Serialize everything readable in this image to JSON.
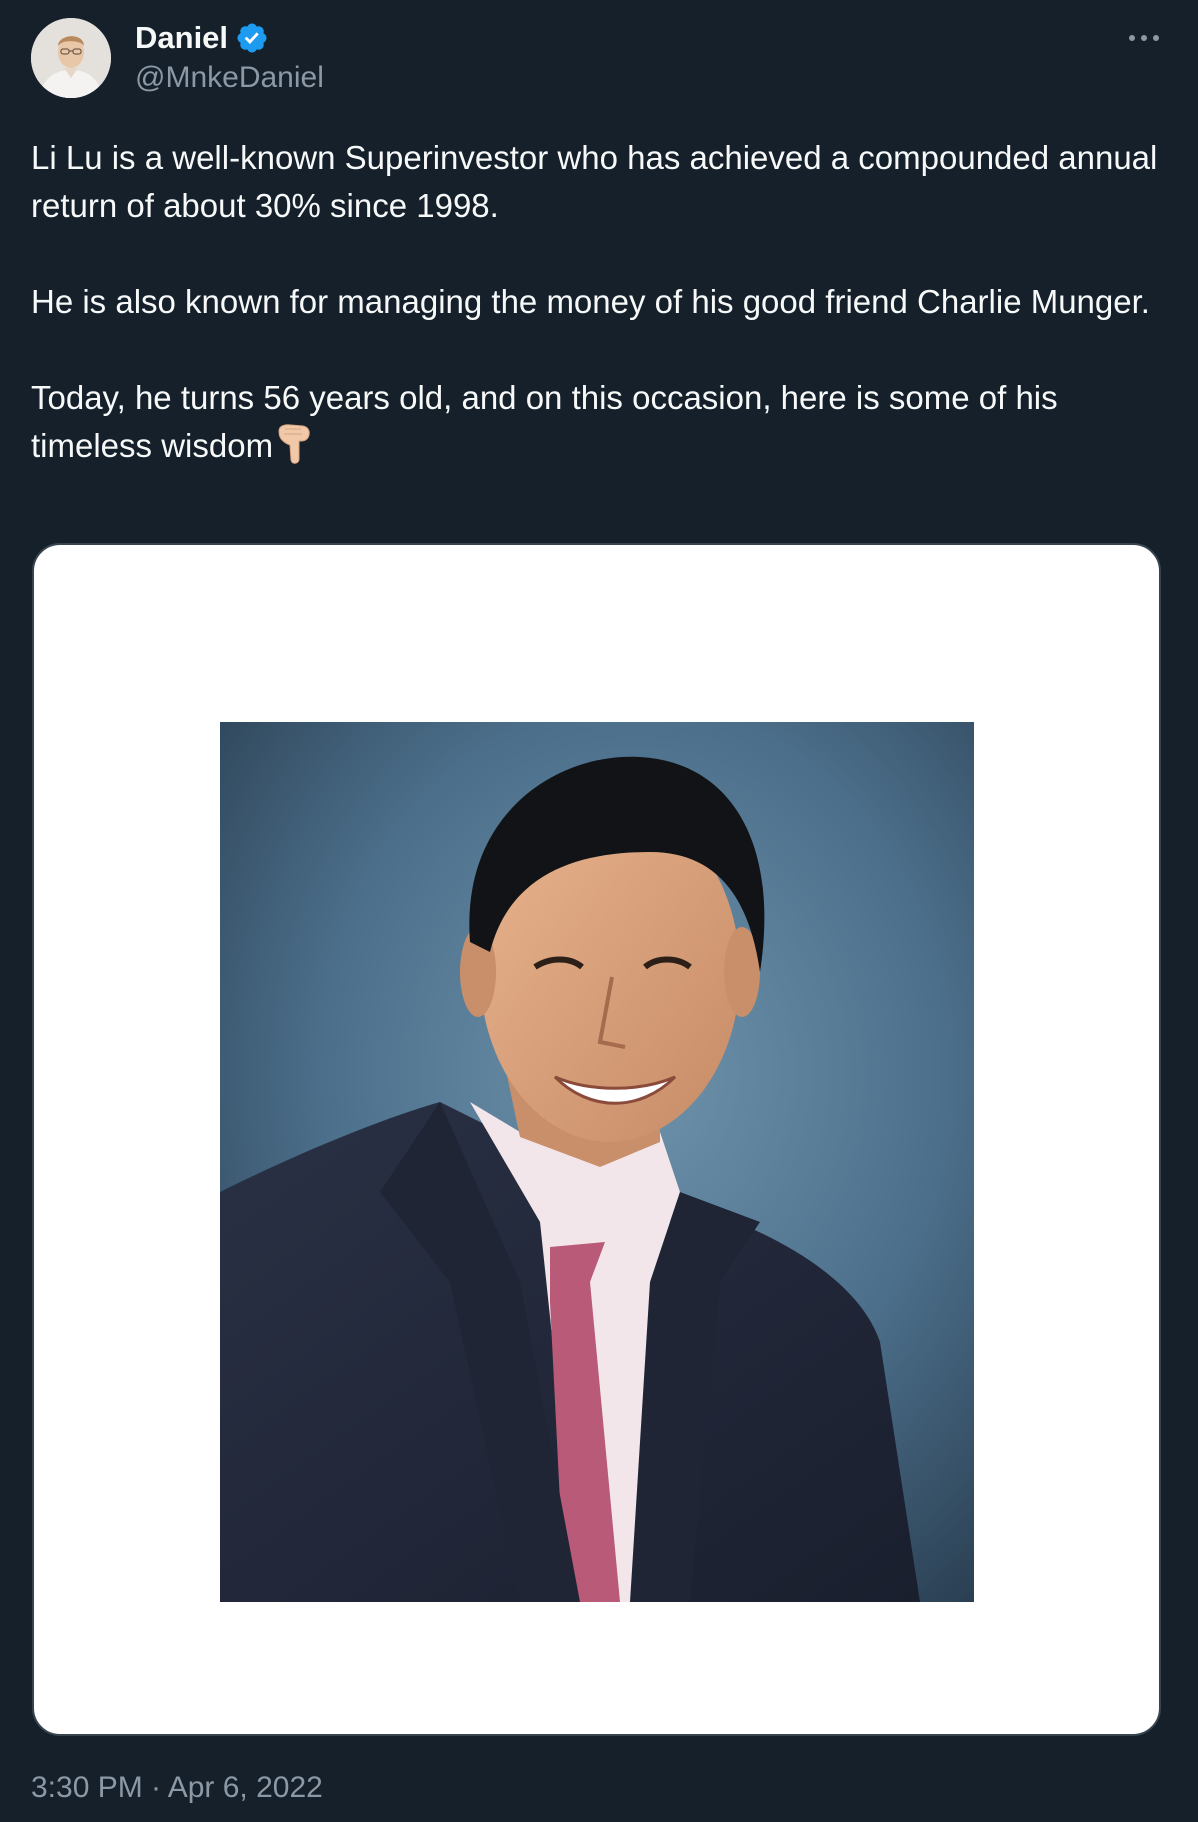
{
  "author": {
    "display_name": "Daniel",
    "handle": "@MnkeDaniel",
    "verified": true,
    "verified_icon": "verified-badge-icon",
    "avatar_icon": "avatar"
  },
  "more_icon": "more-horizontal-icon",
  "tweet": {
    "paragraphs": [
      "Li Lu is a well-known Superinvestor who has achieved a compounded annual return of about 30% since 1998.",
      "He is also known for managing the money of his good friend Charlie Munger.",
      "Today, he turns 56 years old, and on this occasion, here is some of his timeless wisdom"
    ],
    "trailing_emoji": "backhand-index-pointing-down-icon"
  },
  "media": {
    "type": "photo",
    "subject": "portrait-photo"
  },
  "meta": {
    "timestamp": "3:30 PM · Apr 6, 2022"
  },
  "colors": {
    "background": "#15202b",
    "text_primary": "#f7f9f9",
    "text_secondary": "#8b98a5",
    "verified_blue": "#1d9bf0",
    "card_border": "#38444d"
  }
}
